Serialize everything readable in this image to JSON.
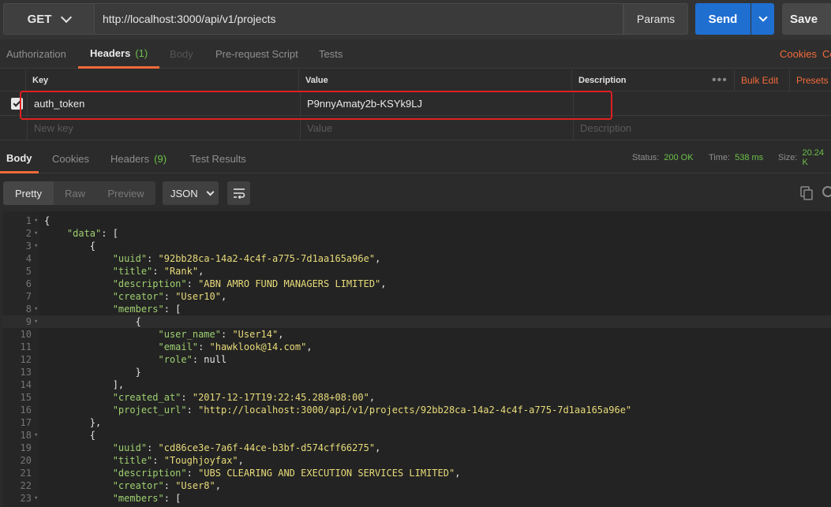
{
  "request": {
    "method": "GET",
    "url": "http://localhost:3000/api/v1/projects",
    "params_label": "Params",
    "send_label": "Send",
    "save_label": "Save"
  },
  "request_tabs": {
    "authorization": "Authorization",
    "headers": "Headers",
    "headers_count": "(1)",
    "body": "Body",
    "prerequest": "Pre-request Script",
    "tests": "Tests",
    "cookies": "Cookies",
    "code": "Co"
  },
  "headers_table": {
    "col_key": "Key",
    "col_value": "Value",
    "col_description": "Description",
    "bulk_edit": "Bulk Edit",
    "presets": "Presets",
    "rows": [
      {
        "key": "auth_token",
        "value": "P9nnyAmaty2b-KSYk9LJ",
        "description": "",
        "checked": true
      }
    ],
    "new_key_placeholder": "New key",
    "value_placeholder": "Value",
    "description_placeholder": "Description"
  },
  "response_tabs": {
    "body": "Body",
    "cookies": "Cookies",
    "headers": "Headers",
    "headers_count": "(9)",
    "test_results": "Test Results"
  },
  "response_status": {
    "status_label": "Status:",
    "status_value": "200 OK",
    "time_label": "Time:",
    "time_value": "538 ms",
    "size_label": "Size:",
    "size_value": "20.24 K"
  },
  "response_view": {
    "pretty": "Pretty",
    "raw": "Raw",
    "preview": "Preview",
    "format": "JSON"
  },
  "colors": {
    "accent": "#f26b3a",
    "send": "#1f6fd1",
    "status_ok": "#6cc04a",
    "json_key": "#9ed070",
    "json_string": "#e8db7a",
    "highlight_border": "#e02020"
  },
  "code_lines": [
    {
      "n": "1",
      "fold": true,
      "text": [
        [
          "p",
          "{"
        ]
      ]
    },
    {
      "n": "2",
      "fold": true,
      "text": [
        [
          "p",
          "    "
        ],
        [
          "k",
          "\"data\""
        ],
        [
          "p",
          ": ["
        ]
      ]
    },
    {
      "n": "3",
      "fold": true,
      "text": [
        [
          "p",
          "        {"
        ]
      ]
    },
    {
      "n": "4",
      "fold": false,
      "text": [
        [
          "p",
          "            "
        ],
        [
          "k",
          "\"uuid\""
        ],
        [
          "p",
          ": "
        ],
        [
          "s",
          "\"92bb28ca-14a2-4c4f-a775-7d1aa165a96e\""
        ],
        [
          "p",
          ","
        ]
      ]
    },
    {
      "n": "5",
      "fold": false,
      "text": [
        [
          "p",
          "            "
        ],
        [
          "k",
          "\"title\""
        ],
        [
          "p",
          ": "
        ],
        [
          "s",
          "\"Rank\""
        ],
        [
          "p",
          ","
        ]
      ]
    },
    {
      "n": "6",
      "fold": false,
      "text": [
        [
          "p",
          "            "
        ],
        [
          "k",
          "\"description\""
        ],
        [
          "p",
          ": "
        ],
        [
          "s",
          "\"ABN AMRO FUND MANAGERS LIMITED\""
        ],
        [
          "p",
          ","
        ]
      ]
    },
    {
      "n": "7",
      "fold": false,
      "text": [
        [
          "p",
          "            "
        ],
        [
          "k",
          "\"creator\""
        ],
        [
          "p",
          ": "
        ],
        [
          "s",
          "\"User10\""
        ],
        [
          "p",
          ","
        ]
      ]
    },
    {
      "n": "8",
      "fold": true,
      "text": [
        [
          "p",
          "            "
        ],
        [
          "k",
          "\"members\""
        ],
        [
          "p",
          ": ["
        ]
      ]
    },
    {
      "n": "9",
      "fold": true,
      "cur": true,
      "text": [
        [
          "p",
          "                {"
        ]
      ]
    },
    {
      "n": "10",
      "fold": false,
      "text": [
        [
          "p",
          "                    "
        ],
        [
          "k",
          "\"user_name\""
        ],
        [
          "p",
          ": "
        ],
        [
          "s",
          "\"User14\""
        ],
        [
          "p",
          ","
        ]
      ]
    },
    {
      "n": "11",
      "fold": false,
      "text": [
        [
          "p",
          "                    "
        ],
        [
          "k",
          "\"email\""
        ],
        [
          "p",
          ": "
        ],
        [
          "s",
          "\"hawklook@14.com\""
        ],
        [
          "p",
          ","
        ]
      ]
    },
    {
      "n": "12",
      "fold": false,
      "text": [
        [
          "p",
          "                    "
        ],
        [
          "k",
          "\"role\""
        ],
        [
          "p",
          ": null"
        ]
      ]
    },
    {
      "n": "13",
      "fold": false,
      "text": [
        [
          "p",
          "                }"
        ]
      ]
    },
    {
      "n": "14",
      "fold": false,
      "text": [
        [
          "p",
          "            ],"
        ]
      ]
    },
    {
      "n": "15",
      "fold": false,
      "text": [
        [
          "p",
          "            "
        ],
        [
          "k",
          "\"created_at\""
        ],
        [
          "p",
          ": "
        ],
        [
          "s",
          "\"2017-12-17T19:22:45.288+08:00\""
        ],
        [
          "p",
          ","
        ]
      ]
    },
    {
      "n": "16",
      "fold": false,
      "text": [
        [
          "p",
          "            "
        ],
        [
          "k",
          "\"project_url\""
        ],
        [
          "p",
          ": "
        ],
        [
          "s",
          "\"http://localhost:3000/api/v1/projects/92bb28ca-14a2-4c4f-a775-7d1aa165a96e\""
        ]
      ]
    },
    {
      "n": "17",
      "fold": false,
      "text": [
        [
          "p",
          "        },"
        ]
      ]
    },
    {
      "n": "18",
      "fold": true,
      "text": [
        [
          "p",
          "        {"
        ]
      ]
    },
    {
      "n": "19",
      "fold": false,
      "text": [
        [
          "p",
          "            "
        ],
        [
          "k",
          "\"uuid\""
        ],
        [
          "p",
          ": "
        ],
        [
          "s",
          "\"cd86ce3e-7a6f-44ce-b3bf-d574cff66275\""
        ],
        [
          "p",
          ","
        ]
      ]
    },
    {
      "n": "20",
      "fold": false,
      "text": [
        [
          "p",
          "            "
        ],
        [
          "k",
          "\"title\""
        ],
        [
          "p",
          ": "
        ],
        [
          "s",
          "\"Toughjoyfax\""
        ],
        [
          "p",
          ","
        ]
      ]
    },
    {
      "n": "21",
      "fold": false,
      "text": [
        [
          "p",
          "            "
        ],
        [
          "k",
          "\"description\""
        ],
        [
          "p",
          ": "
        ],
        [
          "s",
          "\"UBS CLEARING AND EXECUTION SERVICES LIMITED\""
        ],
        [
          "p",
          ","
        ]
      ]
    },
    {
      "n": "22",
      "fold": false,
      "text": [
        [
          "p",
          "            "
        ],
        [
          "k",
          "\"creator\""
        ],
        [
          "p",
          ": "
        ],
        [
          "s",
          "\"User8\""
        ],
        [
          "p",
          ","
        ]
      ]
    },
    {
      "n": "23",
      "fold": true,
      "text": [
        [
          "p",
          "            "
        ],
        [
          "k",
          "\"members\""
        ],
        [
          "p",
          ": ["
        ]
      ]
    }
  ]
}
